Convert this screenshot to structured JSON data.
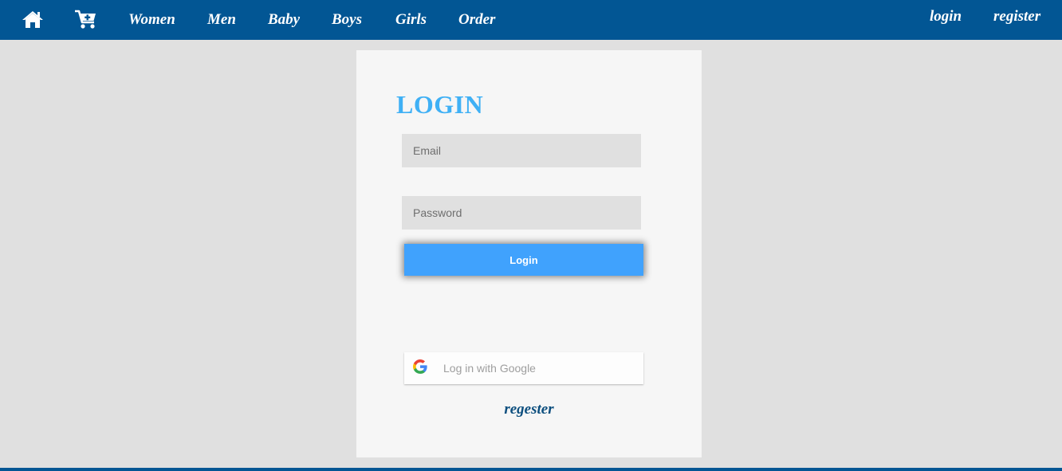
{
  "colors": {
    "nav_bg": "#025694",
    "page_bg": "#e0e0e0",
    "card_bg": "#f6f6f6",
    "title": "#3fb0f5",
    "primary_button": "#40a2fd",
    "register_link": "#0c4e7e"
  },
  "nav": {
    "icons": [
      "home-icon",
      "cart-add-icon"
    ],
    "links": [
      "Women",
      "Men",
      "Baby",
      "Boys",
      "Girls",
      "Order"
    ],
    "auth": {
      "login": "login",
      "register": "register"
    }
  },
  "form": {
    "title": "LOGIN",
    "email": {
      "placeholder": "Email",
      "value": ""
    },
    "password": {
      "placeholder": "Password",
      "value": ""
    },
    "submit_label": "Login",
    "google": {
      "icon": "google-g-icon",
      "label": "Log in with Google"
    },
    "register_label": "regester"
  }
}
